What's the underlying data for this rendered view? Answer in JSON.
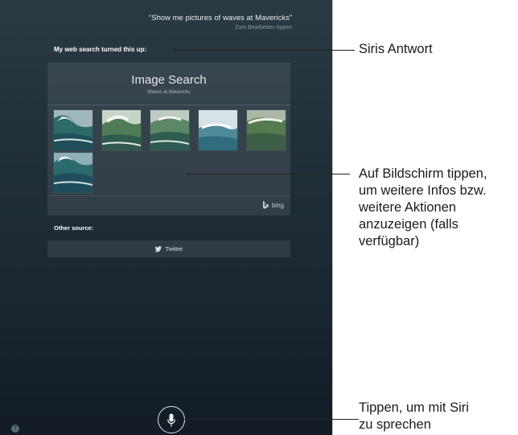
{
  "siri": {
    "query": "“Show me pictures of waves at Mavericks”",
    "edit_hint": "Zum Bearbeiten tippen",
    "answer_heading": "My web search turned this up:",
    "card": {
      "title": "Image Search",
      "subtitle": "Waves at Mavericks",
      "thumbnails": [
        {
          "icon": "wave-photo-icon"
        },
        {
          "icon": "wave-photo-icon"
        },
        {
          "icon": "wave-photo-icon"
        },
        {
          "icon": "wave-photo-icon"
        },
        {
          "icon": "wave-photo-icon"
        },
        {
          "icon": "wave-photo-icon"
        }
      ],
      "provider": "bing"
    },
    "other_source_label": "Other source:",
    "twitter_label": "Twitter",
    "help_label": "?"
  },
  "callouts": {
    "answer": "Siris Antwort",
    "tap_screen": "Auf Bildschirm tippen,\num weitere Infos bzw.\nweitere Aktionen\nanzuzeigen (falls\nverfügbar)",
    "tap_mic": "Tippen, um mit Siri\nzu sprechen"
  },
  "colors": {
    "screen_top": "#2b3942",
    "screen_bottom": "#131c25",
    "callout_text": "#1b1b1b"
  }
}
